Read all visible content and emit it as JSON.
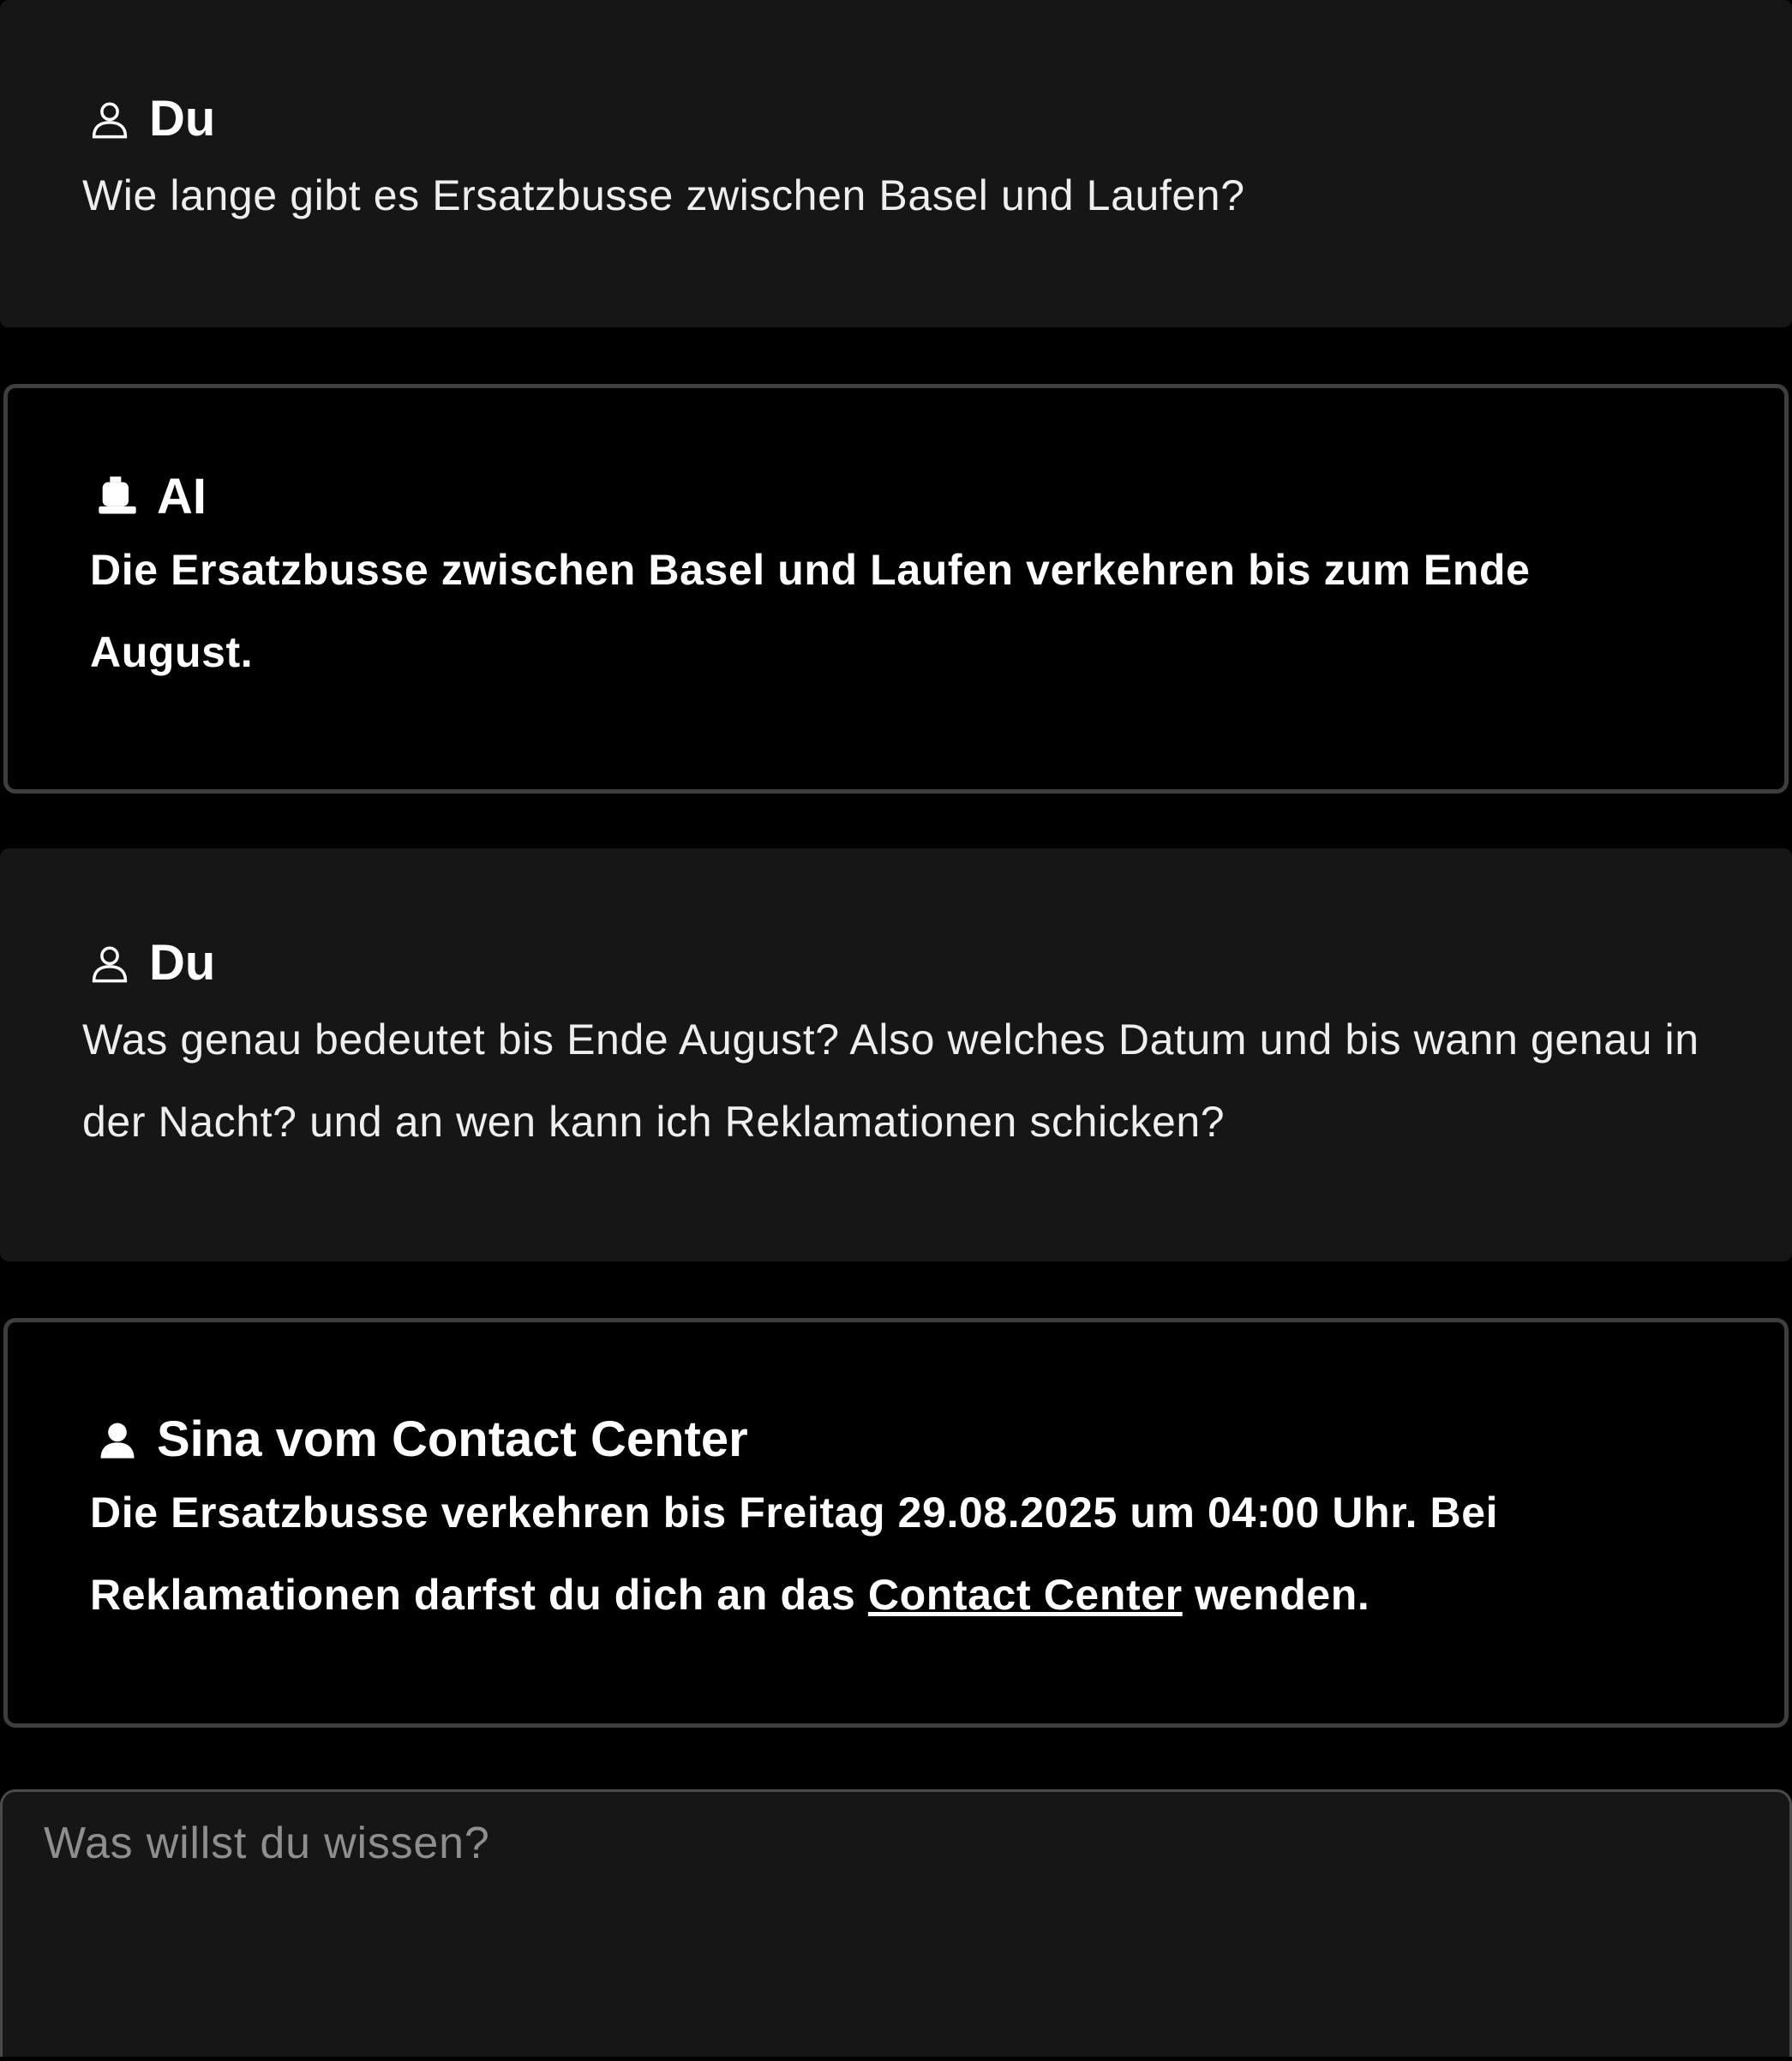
{
  "conversation": {
    "messages": [
      {
        "role": "user",
        "author": "Du",
        "icon": "user-icon",
        "text": "Wie lange gibt es Ersatzbusse zwischen Basel und Laufen?"
      },
      {
        "role": "assistant",
        "author": "AI",
        "icon": "bot-icon",
        "text": "Die Ersatzbusse zwischen Basel und Laufen verkehren bis zum Ende August."
      },
      {
        "role": "user",
        "author": "Du",
        "icon": "user-icon",
        "text": "Was genau bedeutet bis Ende August? Also welches Datum und bis wann genau in der Nacht? und an wen kann ich Reklamationen schicken?"
      },
      {
        "role": "agent",
        "author": "Sina vom Contact Center",
        "icon": "agent-icon",
        "text_before_link": "Die Ersatzbusse verkehren bis Freitag 29.08.2025 um 04:00 Uhr. Bei Reklamationen darfst du dich an das ",
        "link_text": "Contact Center",
        "text_after_link": " wenden."
      }
    ]
  },
  "composer": {
    "placeholder": "Was willst du wissen?",
    "value": ""
  },
  "colors": {
    "background": "#000000",
    "user_bubble": "#161616",
    "bot_border": "#3e3e3e",
    "text": "#f2f2f2",
    "placeholder": "#8e8e8e"
  }
}
